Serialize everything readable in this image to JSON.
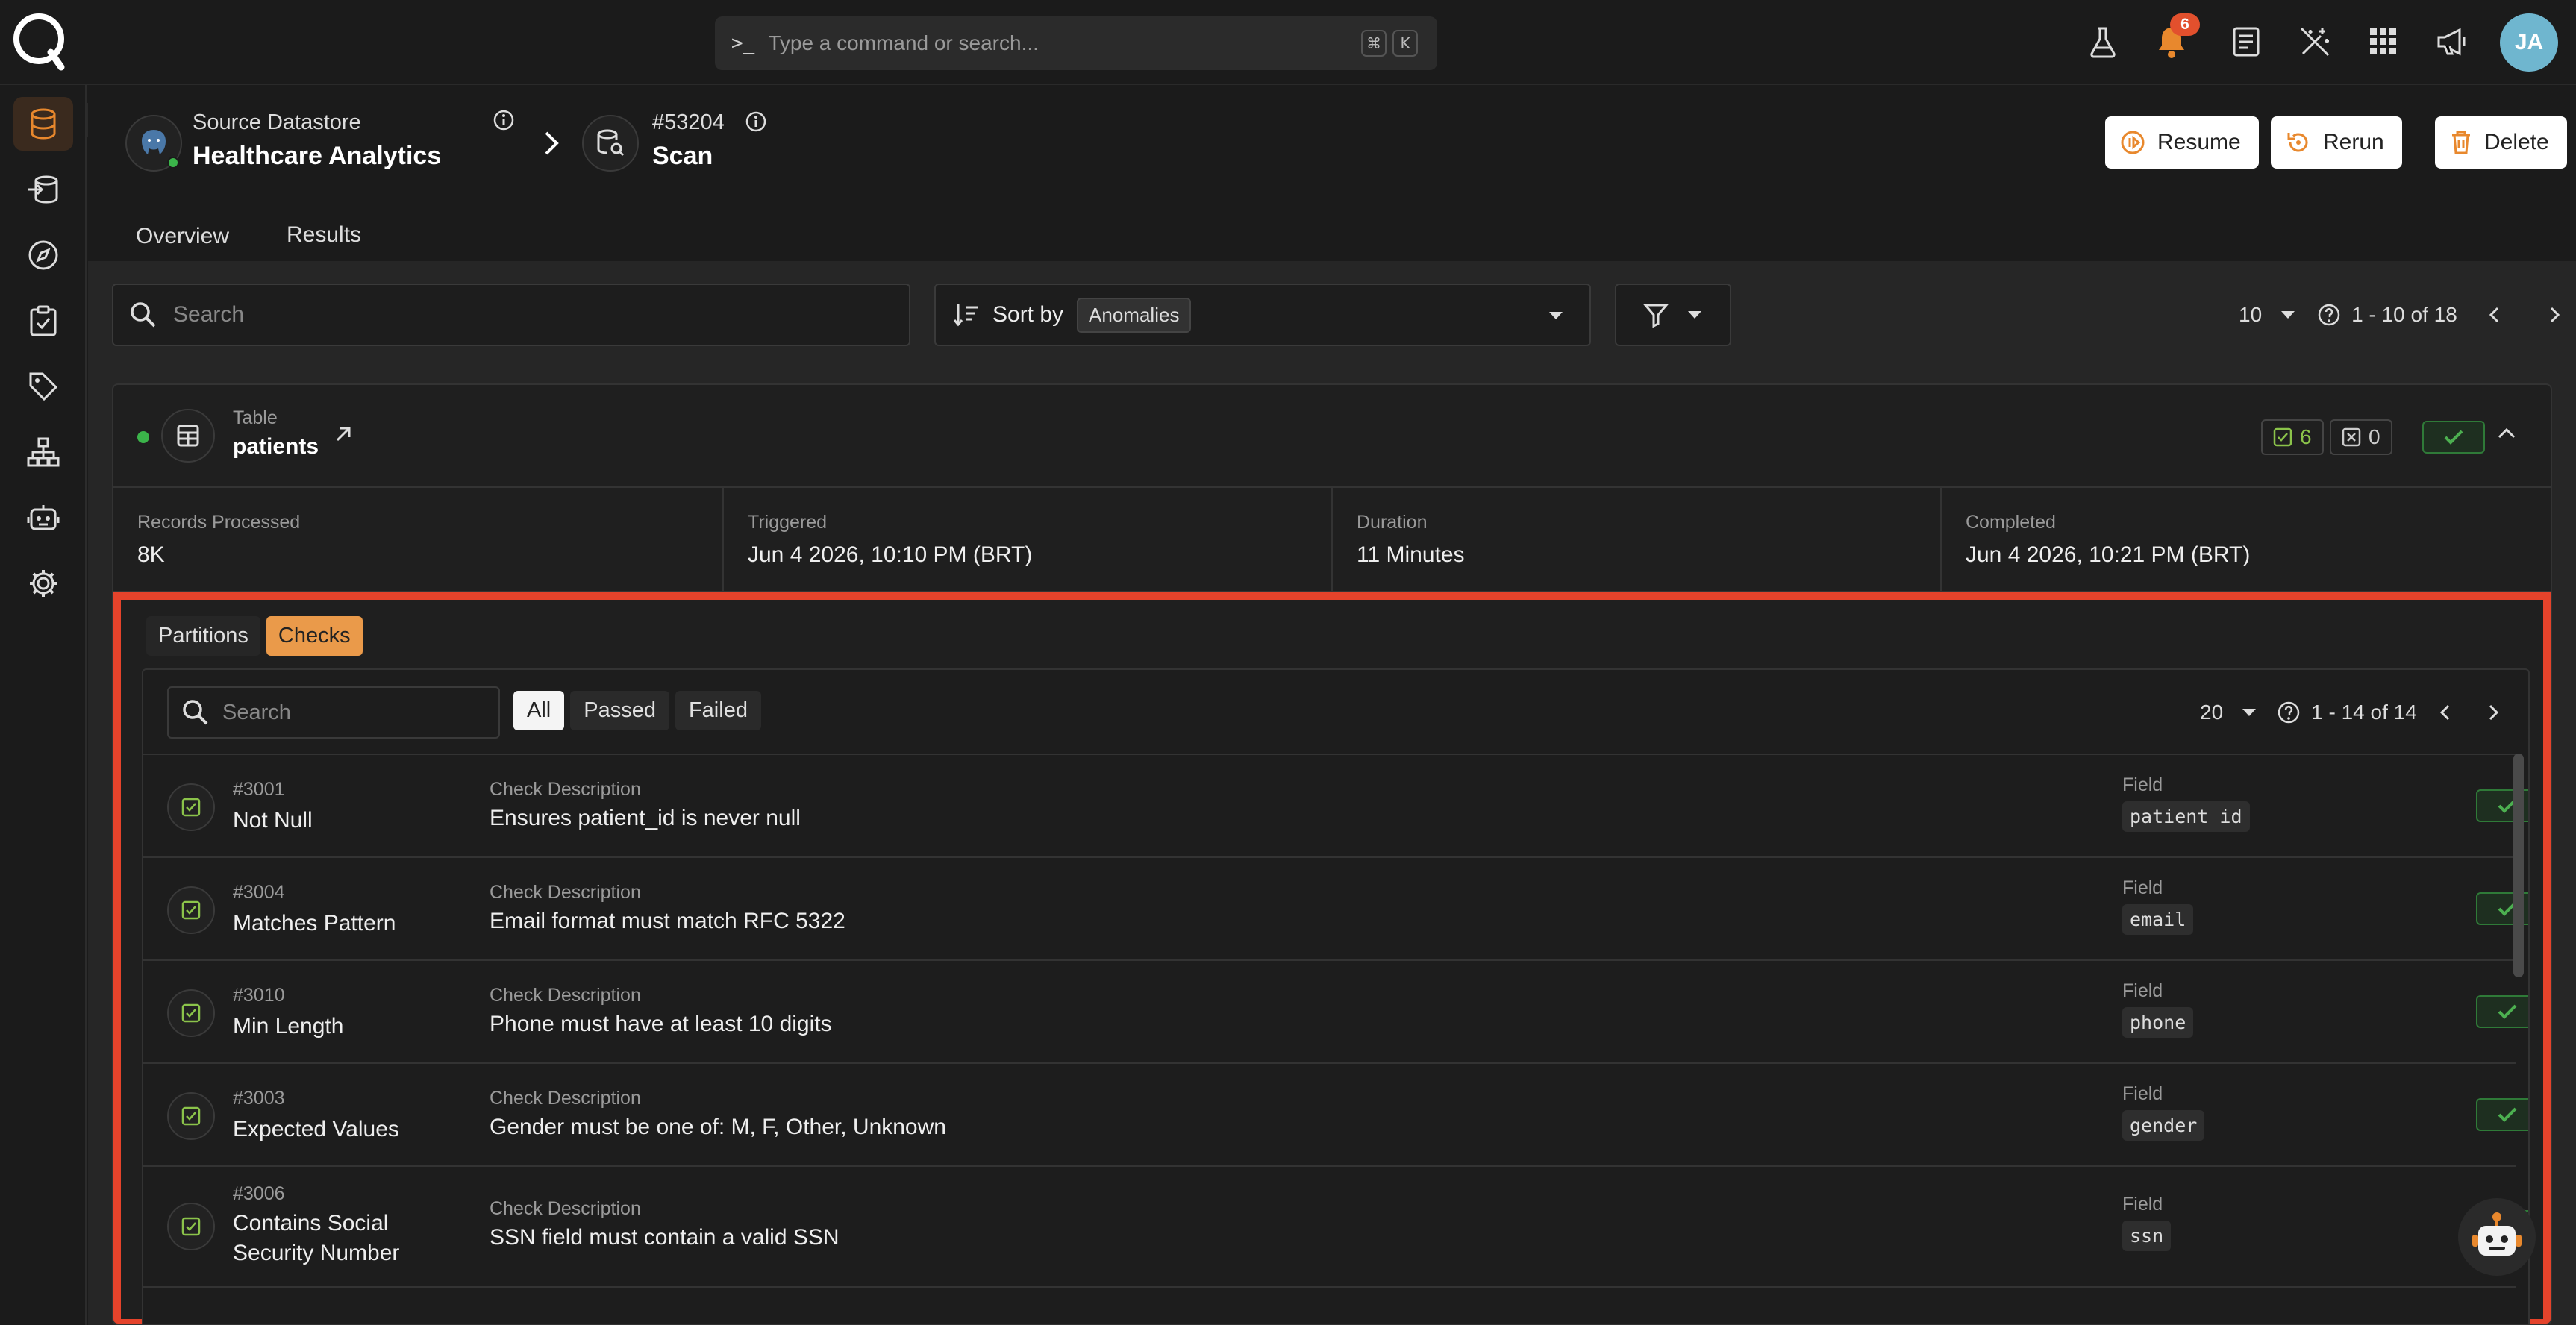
{
  "app": {
    "brand_color": "#e8882d",
    "accent_green": "#3bb44a",
    "highlight": "#e5432b"
  },
  "command": {
    "placeholder": "Type a command or search...",
    "shortcut_mod": "⌘",
    "shortcut_key": "K"
  },
  "topnav": {
    "notifications_count": "6",
    "avatar_initials": "JA",
    "icons": [
      "flask-icon",
      "bell-icon",
      "docs-icon",
      "wand-icon",
      "apps-grid-icon",
      "megaphone-icon"
    ]
  },
  "sidebar": {
    "items": [
      "database-icon",
      "source-icon",
      "explore-icon",
      "checklist-icon",
      "tag-icon",
      "flow-icon",
      "robot-icon",
      "settings-icon"
    ]
  },
  "breadcrumb": {
    "source_label": "Source Datastore",
    "source_name": "Healthcare Analytics",
    "scan_id": "#53204",
    "scan_label": "Scan"
  },
  "actions": {
    "resume": "Resume",
    "rerun": "Rerun",
    "delete": "Delete"
  },
  "tabs": [
    {
      "label": "Overview"
    },
    {
      "label": "Results"
    }
  ],
  "toolbar": {
    "search_placeholder": "Search",
    "sort_label": "Sort by",
    "sort_value": "Anomalies",
    "page_size": "10",
    "range": "1 - 10 of 18"
  },
  "table": {
    "type_label": "Table",
    "name": "patients",
    "passed_count": "6",
    "failed_count": "0"
  },
  "stats": [
    {
      "label": "Records Processed",
      "value": "8K"
    },
    {
      "label": "Triggered",
      "value": "Jun 4 2026, 10:10 PM (BRT)"
    },
    {
      "label": "Duration",
      "value": "11 Minutes"
    },
    {
      "label": "Completed",
      "value": "Jun 4 2026, 10:21 PM (BRT)"
    }
  ],
  "subtabs": [
    {
      "label": "Partitions"
    },
    {
      "label": "Checks"
    }
  ],
  "checks": {
    "search_placeholder": "Search",
    "filters": [
      "All",
      "Passed",
      "Failed"
    ],
    "page_size": "20",
    "range": "1 - 14 of 14",
    "desc_label": "Check Description",
    "field_label": "Field",
    "rows": [
      {
        "id": "#3001",
        "name": "Not Null",
        "desc": "Ensures patient_id is never null",
        "field": "patient_id"
      },
      {
        "id": "#3004",
        "name": "Matches Pattern",
        "desc": "Email format must match RFC 5322",
        "field": "email"
      },
      {
        "id": "#3010",
        "name": "Min Length",
        "desc": "Phone must have at least 10 digits",
        "field": "phone"
      },
      {
        "id": "#3003",
        "name": "Expected Values",
        "desc": "Gender must be one of: M, F, Other, Unknown",
        "field": "gender"
      },
      {
        "id": "#3006",
        "name": "Contains Social Security Number",
        "desc": "SSN field must contain a valid SSN",
        "field": "ssn"
      }
    ]
  }
}
